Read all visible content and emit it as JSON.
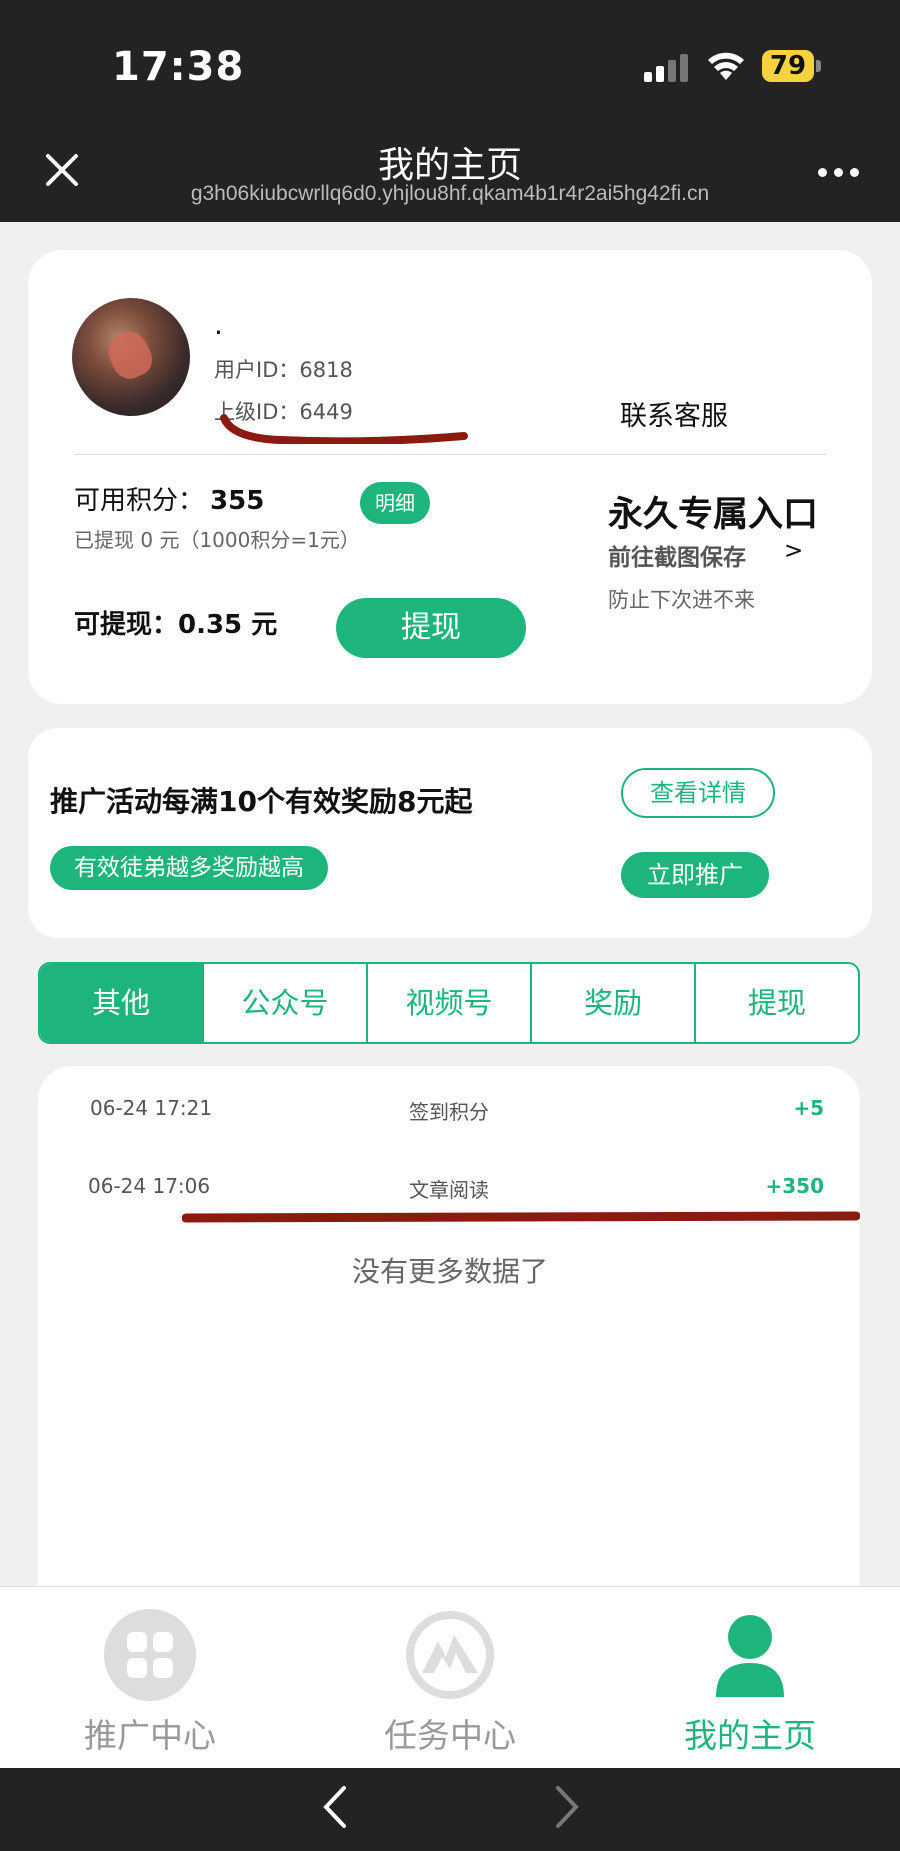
{
  "status": {
    "time": "17:38",
    "battery": "79"
  },
  "header": {
    "title": "我的主页",
    "url": "g3h06kiubcwrllq6d0.yhjlou8hf.qkam4b1r4r2ai5hg42fi.cn"
  },
  "profile": {
    "nickname": ".",
    "user_id_label": "用户ID：6818",
    "parent_id_label": "上级ID：6449",
    "contact_label": "联系客服",
    "points_label": "可用积分：",
    "points_value": "355",
    "detail_label": "明细",
    "withdrawn_text": "已提现 0 元（1000积分=1元）",
    "withdrawable_text": "可提现：0.35 元",
    "withdraw_button": "提现",
    "exclusive_title": "永久专属入口",
    "exclusive_sub": "前往截图保存",
    "exclusive_arrow": ">",
    "exclusive_note": "防止下次进不来"
  },
  "promo": {
    "title": "推广活动每满10个有效奖励8元起",
    "tag": "有效徒弟越多奖励越高",
    "view_button": "查看详情",
    "promote_button": "立即推广"
  },
  "tabs": [
    {
      "label": "其他",
      "active": true
    },
    {
      "label": "公众号",
      "active": false
    },
    {
      "label": "视频号",
      "active": false
    },
    {
      "label": "奖励",
      "active": false
    },
    {
      "label": "提现",
      "active": false
    }
  ],
  "records": [
    {
      "date": "06-24 17:21",
      "title": "签到积分",
      "value": "+5"
    },
    {
      "date": "06-24 17:06",
      "title": "文章阅读",
      "value": "+350"
    }
  ],
  "no_more": "没有更多数据了",
  "bottom_nav": [
    {
      "label": "推广中心",
      "icon": "grid-icon",
      "active": false
    },
    {
      "label": "任务中心",
      "icon": "mountain-icon",
      "active": false
    },
    {
      "label": "我的主页",
      "icon": "person-icon",
      "active": true
    }
  ],
  "colors": {
    "accent": "#1eb57d",
    "annotation": "#8b1a10",
    "bar": "#232323"
  }
}
